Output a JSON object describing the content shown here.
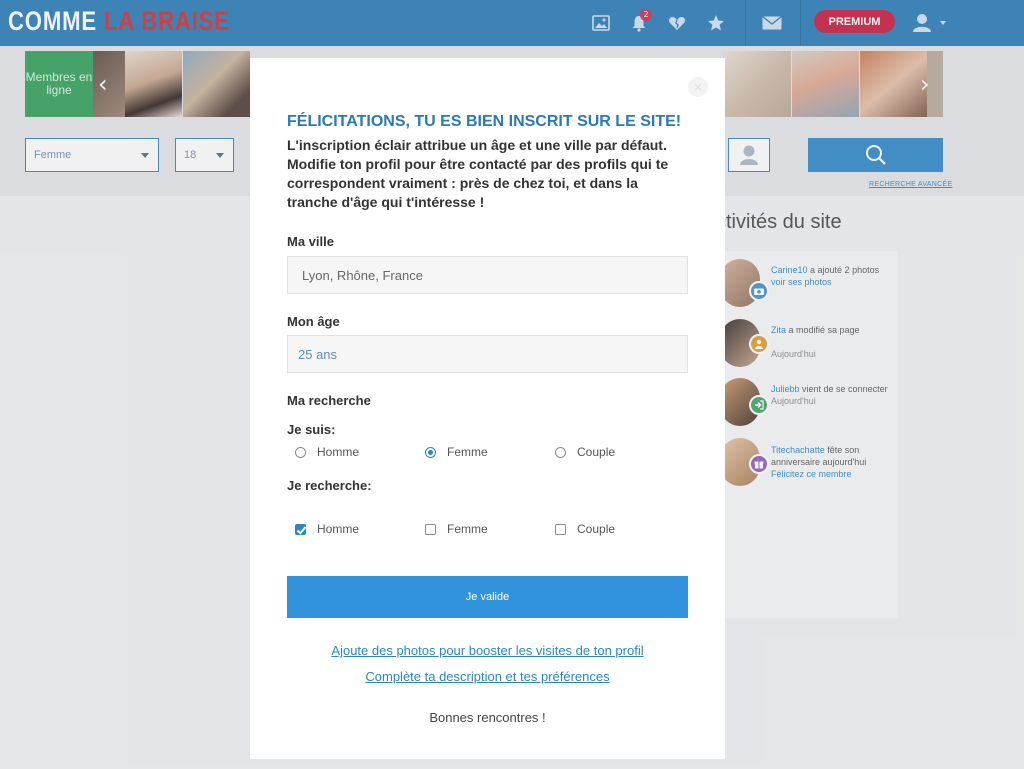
{
  "header": {
    "logo_part1": "COMME",
    "logo_part2": "LA BRAISE",
    "notif_count": "2",
    "premium_label": "PREMIUM",
    "brand_color": "#2479b8",
    "premium_color": "#c8173e"
  },
  "carousel": {
    "online_label": "Membres en ligne"
  },
  "search": {
    "gender_value": "Femme",
    "age_value": "18",
    "advanced_label": "RECHERCHE AVANCÉE"
  },
  "activity": {
    "title": "ctivités du site",
    "items": [
      {
        "name": "Carine10",
        "action": " a ajouté 2 photos",
        "link": "voir ses photos",
        "time": ""
      },
      {
        "name": "Zita",
        "action": " a modifié sa page",
        "link": "",
        "time": "Aujourd'hui"
      },
      {
        "name": "Juliebb",
        "action": " vient de se connecter",
        "link": "",
        "time": "Aujourd'hui"
      },
      {
        "name": "Titechachatte",
        "action": " fête son anniversaire aujourd'hui",
        "link": "Félicitez ce membre",
        "time": ""
      }
    ]
  },
  "modal": {
    "title": "FÉLICITATIONS, TU ES BIEN INSCRIT SUR LE SITE!",
    "intro": "L'inscription éclair attribue un âge et une ville par défaut. Modifie ton profil pour être contacté par des profils qui te correspondent vraiment : près de chez toi, et dans la tranche d'âge qui t'intéresse !",
    "city_label": "Ma ville",
    "city_value": "Lyon, Rhône, France",
    "age_label": "Mon âge",
    "age_value": "25 ans",
    "search_label": "Ma recherche",
    "i_am_label": "Je suis:",
    "i_am_options": [
      "Homme",
      "Femme",
      "Couple"
    ],
    "i_am_selected": "Femme",
    "looking_label": "Je recherche:",
    "looking_options": [
      "Homme",
      "Femme",
      "Couple"
    ],
    "looking_checked": [
      "Homme"
    ],
    "submit_label": "Je valide",
    "link_photos": "Ajoute des photos pour booster les visites de ton profil",
    "link_description": "Complète ta description et tes préférences",
    "closing": "Bonnes rencontres !",
    "accent_color": "#3193dc"
  }
}
